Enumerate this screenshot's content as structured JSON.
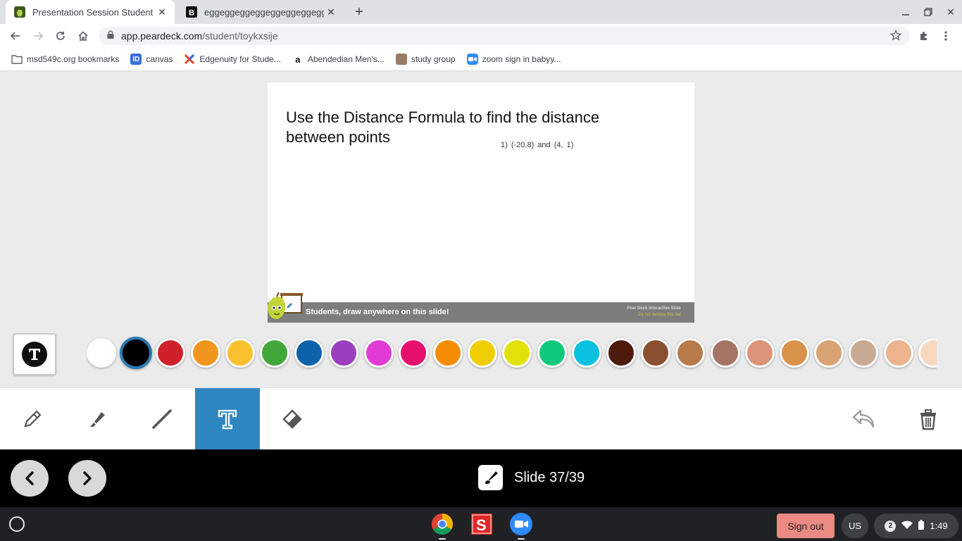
{
  "browser": {
    "tabs": [
      {
        "title": "Presentation Session Student",
        "active": true
      },
      {
        "title": "eggeggeggeggeggeggeggeggegg",
        "active": false
      }
    ],
    "url_host": "app.peardeck.com",
    "url_path": "/student/toykxsije",
    "bookmarks": [
      {
        "label": "msd549c.org bookmarks",
        "icon": "folder-icon"
      },
      {
        "label": "canvas",
        "icon": "canvas-icon"
      },
      {
        "label": "Edgenuity for Stude...",
        "icon": "edgenuity-icon"
      },
      {
        "label": "Abendedian Men's...",
        "icon": "amazon-icon"
      },
      {
        "label": "study group",
        "icon": "photo-icon"
      },
      {
        "label": "zoom sign in babyy...",
        "icon": "zoom-icon"
      }
    ]
  },
  "slide": {
    "title": "Use the Distance Formula to find the distance between points",
    "problem": "1)    (-20,8) and (4, 1)",
    "footer_message": "Students, draw anywhere on this slide!",
    "footer_brand": "Pear Deck Interactive Slide",
    "footer_brand_sub": "Do not remove this bar"
  },
  "palette": {
    "selected_index": 1,
    "colors": [
      "#ffffff",
      "#000000",
      "#d0202a",
      "#f0961e",
      "#fbc02d",
      "#43a83c",
      "#0d62aa",
      "#9b3fbe",
      "#e13ad6",
      "#e6116d",
      "#f58c00",
      "#f0cd00",
      "#e2e20a",
      "#0fc97b",
      "#0ac1e0",
      "#4e1a0c",
      "#8b5030",
      "#b87a4b",
      "#a57465",
      "#dd9377",
      "#d9924a",
      "#d8a374",
      "#c8aa94",
      "#ebb38e",
      "#f7d9c0"
    ]
  },
  "tools": {
    "items": [
      "pencil-icon",
      "marker-icon",
      "line-icon",
      "text-icon",
      "eraser-icon"
    ],
    "active": "text-icon"
  },
  "nav": {
    "slide_indicator": "Slide 37/39"
  },
  "shelf": {
    "sign_out": "Sign out",
    "input_method": "US",
    "notifications": "2",
    "time": "1:49"
  }
}
